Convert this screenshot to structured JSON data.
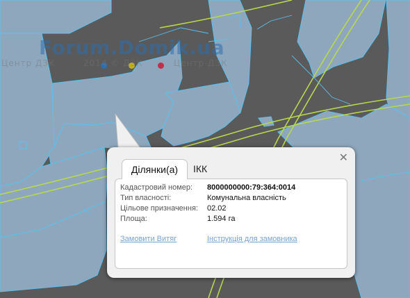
{
  "map": {
    "colors": {
      "background": "#5a5a5a",
      "parcel_fill": "#8ea7bd",
      "parcel_stroke": "#5bc0ef",
      "road_line": "#b9d94a"
    },
    "watermark": {
      "logo": "Forum.Domik.ua",
      "text_1": "Центр ДЗК",
      "text_2": "2014 © ДЗК",
      "text_3": "Центр ДЗК",
      "dots": [
        "#2e6fb0",
        "#c0b020",
        "#c0304a"
      ]
    }
  },
  "popup": {
    "close_icon": "✕",
    "tabs": [
      {
        "label": "Ділянки(а)",
        "active": true
      },
      {
        "label": "ІКК",
        "active": false
      }
    ],
    "fields": [
      {
        "label": "Кадастровий номер:",
        "value": "8000000000:79:364:0014"
      },
      {
        "label": "Тип власності:",
        "value": "Комунальна власність"
      },
      {
        "label": "Цільове призначення:",
        "value": "02.02"
      },
      {
        "label": "Площа:",
        "value": "1.594 га"
      }
    ],
    "links": {
      "order_extract": "Замовити Витяг",
      "instructions": "Інструкція для замовника"
    }
  }
}
